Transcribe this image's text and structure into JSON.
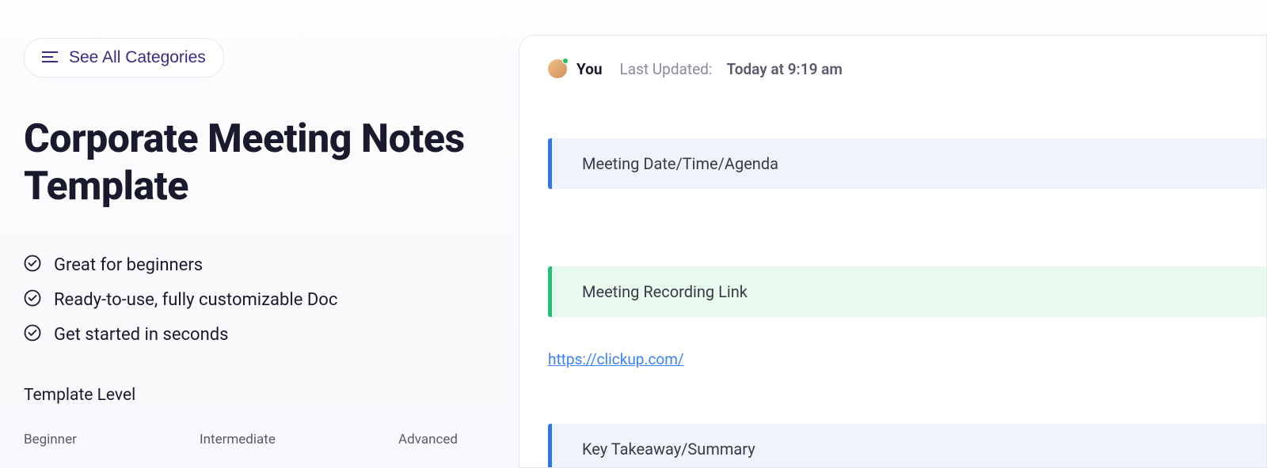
{
  "categoriesBtn": "See All Categories",
  "title": "Corporate Meeting Notes Template",
  "features": [
    "Great for beginners",
    "Ready-to-use, fully customizable Doc",
    "Get started in seconds"
  ],
  "templateLevelLabel": "Template Level",
  "levels": {
    "beginner": "Beginner",
    "intermediate": "Intermediate",
    "advanced": "Advanced"
  },
  "doc": {
    "author": "You",
    "lastUpdatedLabel": "Last Updated:",
    "lastUpdatedTime": "Today at 9:19 am",
    "sections": {
      "agenda": "Meeting Date/Time/Agenda",
      "recording": "Meeting Recording Link",
      "summary": "Key Takeaway/Summary"
    },
    "recordingLink": "https://clickup.com/"
  }
}
